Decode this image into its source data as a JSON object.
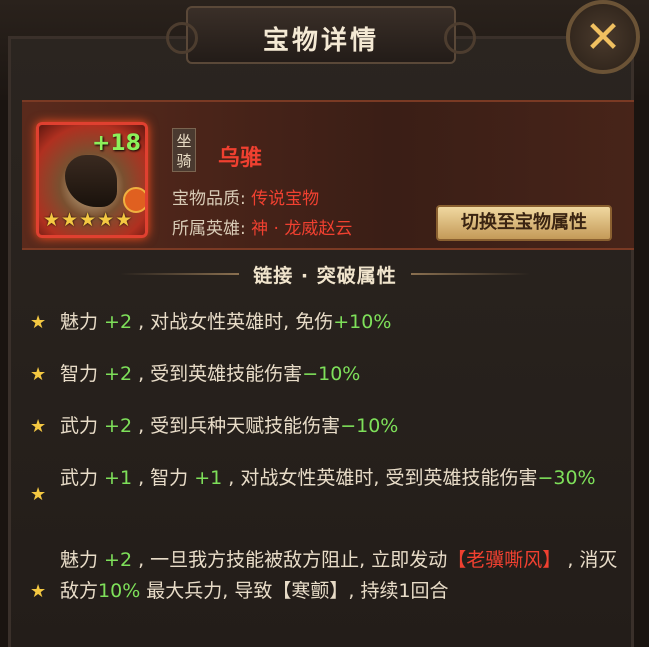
{
  "window": {
    "title": "宝物详情",
    "close_icon": "close-x-icon"
  },
  "treasure": {
    "plus_level": "+18",
    "star_count": 5,
    "category": "坐骑",
    "name": "乌骓",
    "quality_label": "宝物品质:",
    "quality_value": "传说宝物",
    "hero_label": "所属英雄:",
    "hero_value": "神 · 龙威赵云",
    "switch_button": "切换至宝物属性"
  },
  "section": {
    "title": "链接 · 突破属性"
  },
  "attributes": [
    {
      "segments": [
        [
          "魅力 ",
          ""
        ],
        [
          "+2",
          "g"
        ],
        [
          " , 对战女性英雄时, 免伤",
          ""
        ],
        [
          "+10%",
          "g"
        ]
      ]
    },
    {
      "segments": [
        [
          "智力 ",
          ""
        ],
        [
          "+2",
          "g"
        ],
        [
          " , 受到英雄技能伤害",
          ""
        ],
        [
          "−10%",
          "g"
        ]
      ]
    },
    {
      "segments": [
        [
          "武力 ",
          ""
        ],
        [
          "+2",
          "g"
        ],
        [
          " , 受到兵种天赋技能伤害",
          ""
        ],
        [
          "−10%",
          "g"
        ]
      ]
    },
    {
      "segments": [
        [
          "武力 ",
          ""
        ],
        [
          "+1",
          "g"
        ],
        [
          " , 智力 ",
          ""
        ],
        [
          "+1",
          "g"
        ],
        [
          " , 对战女性英雄时, 受到英雄技能伤害",
          ""
        ],
        [
          "−30%",
          "g"
        ]
      ]
    },
    {
      "segments": [
        [
          "魅力 ",
          ""
        ],
        [
          "+2",
          "g"
        ],
        [
          " , 一旦我方技能被敌方阻止, 立即发动",
          ""
        ],
        [
          "【老骥嘶风】",
          "r"
        ],
        [
          " , 消灭敌方",
          ""
        ],
        [
          "10%",
          "g"
        ],
        [
          " 最大兵力, 导致【寒颤】, 持续1回合",
          ""
        ]
      ]
    }
  ],
  "colors": {
    "accent_red": "#f04030",
    "accent_green": "#7ee05a",
    "star_gold": "#f4c842"
  }
}
